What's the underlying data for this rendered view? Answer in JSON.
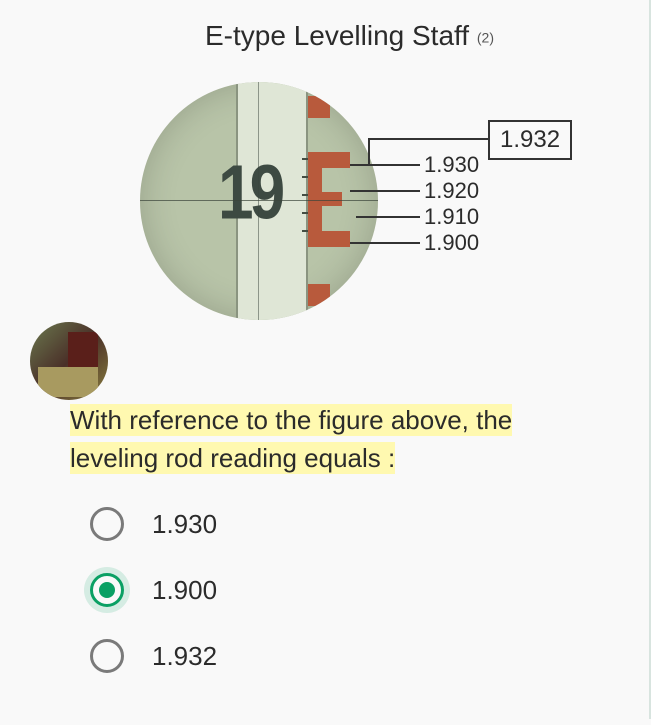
{
  "title": "E-type Levelling Staff",
  "title_annotation": "(2)",
  "figure": {
    "staff_big_number": "19",
    "boxed_reading": "1.932",
    "graduation_labels": [
      "1.930",
      "1.920",
      "1.910",
      "1.900"
    ]
  },
  "question_line1": "With reference to the figure above, the",
  "question_line2": "leveling rod reading equals :",
  "options": [
    {
      "label": "1.930",
      "selected": false
    },
    {
      "label": "1.900",
      "selected": true
    },
    {
      "label": "1.932",
      "selected": false
    }
  ]
}
